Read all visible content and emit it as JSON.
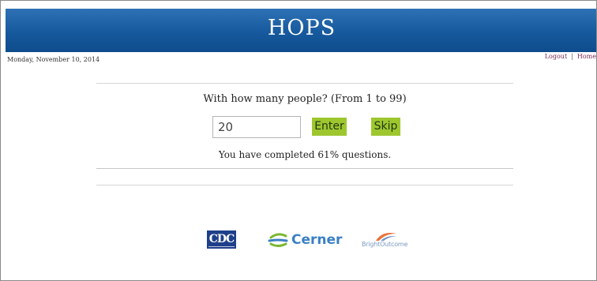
{
  "header": {
    "title": "HOPS"
  },
  "topbar": {
    "date": "Monday, November 10, 2014",
    "links": [
      {
        "label": "Logout"
      },
      {
        "label": "Home"
      }
    ],
    "separator": "|"
  },
  "question": {
    "text": "With how many people? (From 1 to 99)",
    "input_value": "20",
    "enter_label": "Enter",
    "skip_label": "Skip"
  },
  "progress": {
    "text": "You have completed 61% questions.",
    "percent": 61
  },
  "footer": {
    "logos": [
      {
        "name": "cdc-logo",
        "text": "CDC"
      },
      {
        "name": "cerner-logo",
        "text": "Cerner"
      },
      {
        "name": "brightoutcome-logo",
        "text": "BrightOutcome"
      }
    ]
  },
  "colors": {
    "header_bg": "#16599d",
    "button_bg": "#9ec72f",
    "link": "#7a2a5a",
    "cdc_blue": "#1e3f8a",
    "cerner_blue": "#3a80c4",
    "cerner_green": "#7ab92f",
    "bright_orange": "#e8743b"
  }
}
